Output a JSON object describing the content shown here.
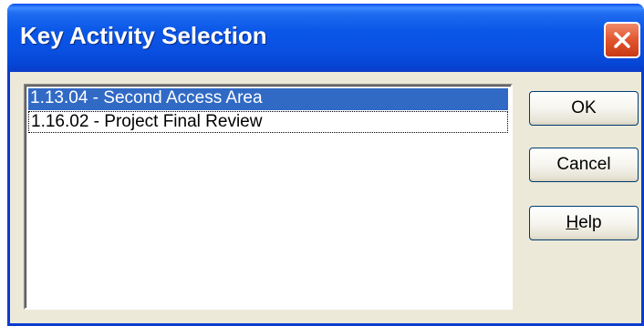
{
  "window": {
    "title": "Key Activity Selection",
    "close_icon": "close-x-icon"
  },
  "list": {
    "items": [
      {
        "label": "1.13.04 - Second Access Area",
        "selected": true
      },
      {
        "label": "1.16.02 - Project Final Review",
        "selected": false,
        "focused": true
      }
    ]
  },
  "buttons": {
    "ok_label": "OK",
    "cancel_label": "Cancel",
    "help_mnemonic": "H",
    "help_rest": "elp"
  },
  "colors": {
    "titlebar": "#0a57e8",
    "selection": "#316ac5",
    "dialog_bg": "#ece9d8",
    "close_button": "#e0552e"
  }
}
